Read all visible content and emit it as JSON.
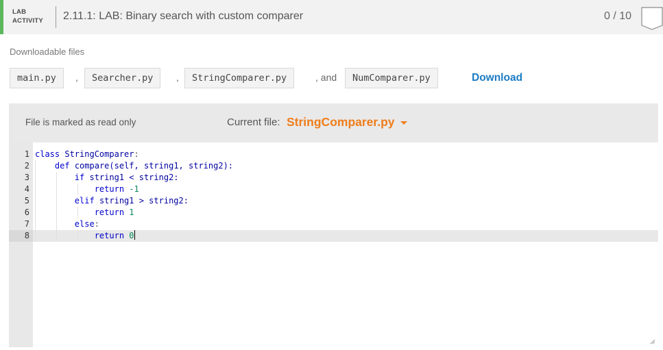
{
  "header": {
    "lab_label_line1": "LAB",
    "lab_label_line2": "ACTIVITY",
    "title": "2.11.1: LAB: Binary search with custom comparer",
    "score": "0 / 10",
    "accent_color": "#5cb85c"
  },
  "downloads": {
    "heading": "Downloadable files",
    "files": [
      "main.py",
      "Searcher.py",
      "StringComparer.py",
      "NumComparer.py"
    ],
    "separators": [
      ",",
      ",",
      ", and"
    ],
    "download_label": "Download",
    "link_color": "#1b7bc3"
  },
  "editor_panel": {
    "readonly_note": "File is marked as read only",
    "current_file_label": "Current file:",
    "current_file": "StringComparer.py",
    "current_file_color": "#ef7d1a",
    "icon_dropdown": "chevron-down-icon",
    "line_numbers": [
      "1",
      "2",
      "3",
      "4",
      "5",
      "6",
      "7",
      "8"
    ],
    "active_line": 8,
    "code": {
      "l1": {
        "kw": "class",
        "name": "StringComparer",
        "rest": ":"
      },
      "l2": {
        "kw": "def",
        "name": "compare",
        "rest": "(self, string1, string2):"
      },
      "l3": {
        "kw": "if",
        "rest": "string1 < string2:"
      },
      "l4": {
        "kw": "return",
        "num": "-1"
      },
      "l5": {
        "kw": "elif",
        "rest": "string1 > string2:"
      },
      "l6": {
        "kw": "return",
        "num": "1"
      },
      "l7": {
        "kw": "else",
        "rest": ":"
      },
      "l8": {
        "kw": "return",
        "num": "0"
      }
    }
  }
}
